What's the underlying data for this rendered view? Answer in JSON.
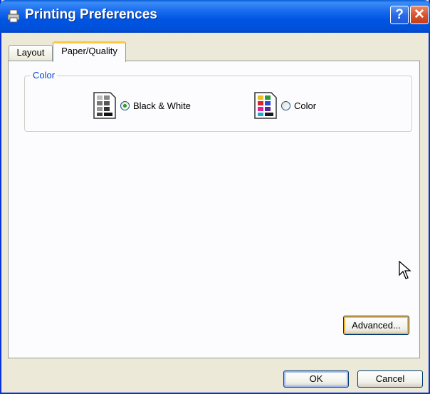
{
  "window": {
    "title": "Printing Preferences",
    "help_label": "?",
    "close_label": "✕"
  },
  "tabs": [
    {
      "label": "Layout",
      "active": false
    },
    {
      "label": "Paper/Quality",
      "active": true
    }
  ],
  "color_group": {
    "legend": "Color",
    "options": [
      {
        "label": "Black & White",
        "selected": true,
        "icon": "grayscale-document-icon"
      },
      {
        "label": "Color",
        "selected": false,
        "icon": "color-document-icon"
      }
    ]
  },
  "buttons": {
    "advanced": "Advanced...",
    "ok": "OK",
    "cancel": "Cancel"
  },
  "colors": {
    "titlebar": "#0054e3",
    "accent": "#0046d5",
    "face": "#ece9d8"
  }
}
